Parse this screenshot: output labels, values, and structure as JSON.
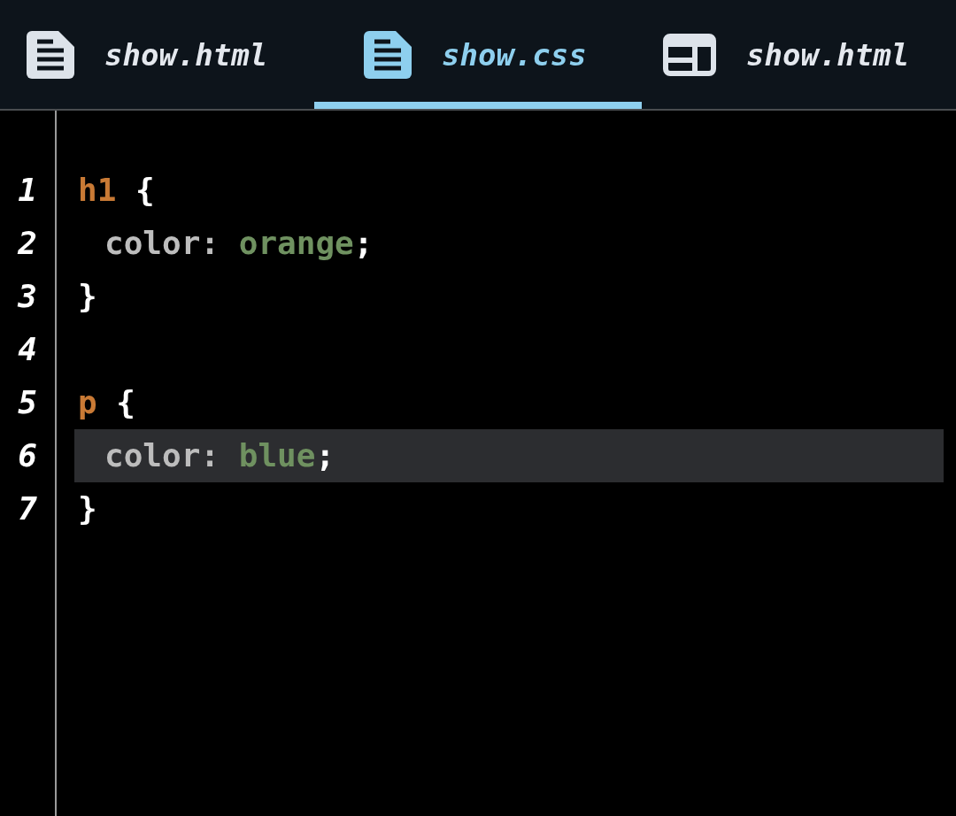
{
  "tabs": [
    {
      "label": "show.html",
      "selected": false
    },
    {
      "label": "show.css",
      "selected": true
    },
    {
      "label": "show.html",
      "selected": false
    }
  ],
  "editor": {
    "lines": [
      {
        "number": "1",
        "indented": false,
        "current": false,
        "tokens": [
          {
            "kind": "selector",
            "text": "h1"
          },
          {
            "kind": "punct",
            "text": " {"
          }
        ]
      },
      {
        "number": "2",
        "indented": true,
        "current": false,
        "tokens": [
          {
            "kind": "property",
            "text": "color:"
          },
          {
            "kind": "value",
            "text": " orange"
          },
          {
            "kind": "punct",
            "text": ";"
          }
        ]
      },
      {
        "number": "3",
        "indented": false,
        "current": false,
        "tokens": [
          {
            "kind": "punct",
            "text": "}"
          }
        ]
      },
      {
        "number": "4"
      },
      {
        "number": "5",
        "indented": false,
        "current": false,
        "tokens": [
          {
            "kind": "selector",
            "text": "p"
          },
          {
            "kind": "punct",
            "text": " {"
          }
        ]
      },
      {
        "number": "6",
        "indented": true,
        "current": true,
        "tokens": [
          {
            "kind": "property",
            "text": "color:"
          },
          {
            "kind": "value",
            "text": " blue"
          },
          {
            "kind": "punct",
            "text": ";"
          }
        ]
      },
      {
        "number": "7",
        "indented": false,
        "current": false,
        "tokens": [
          {
            "kind": "punct",
            "text": "}"
          }
        ]
      }
    ]
  }
}
